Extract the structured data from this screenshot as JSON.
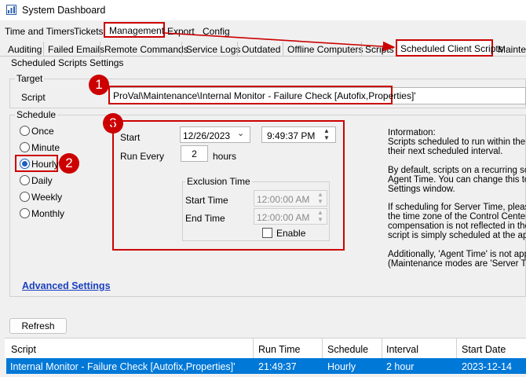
{
  "window": {
    "title": "System Dashboard",
    "icon": "dashboard-icon"
  },
  "menu_tabs": [
    "Time and Timers",
    "Tickets",
    "Management",
    "Export",
    "Config"
  ],
  "sub_tabs": [
    "Auditing",
    "Failed Emails",
    "Remote Commands",
    "Service Logs",
    "Outdated",
    "Offline Computers",
    "Scripts",
    "Scheduled Client Scripts",
    "Mainter"
  ],
  "section_title": "Scheduled Scripts Settings",
  "target": {
    "label": "Target",
    "script_label": "Script",
    "script_value": "ProVal\\Maintenance\\Internal Monitor - Failure Check [Autofix,Properties]'"
  },
  "schedule": {
    "label": "Schedule",
    "options": [
      "Once",
      "Minute",
      "Hourly",
      "Daily",
      "Weekly",
      "Monthly"
    ],
    "selected": "Hourly",
    "start_label": "Start",
    "start_date": "12/26/2023",
    "start_time": "9:49:37 PM",
    "run_every_label": "Run Every",
    "run_every_value": "2",
    "run_every_unit": "hours"
  },
  "exclusion": {
    "label": "Exclusion Time",
    "start_label": "Start Time",
    "start_value": "12:00:00 AM",
    "end_label": "End Time",
    "end_value": "12:00:00 AM",
    "enable_label": "Enable",
    "enabled": false
  },
  "information": [
    "Information:",
    "Scripts scheduled to run within the ne",
    "their next scheduled interval.",
    "",
    "By default, scripts on a recurring sche",
    "Agent Time. You can change this to '",
    "Settings window.",
    "",
    "If scheduling for Server Time, please",
    "the time zone of the Control Center in",
    "compensation is not reflected in the R",
    "script is simply scheduled at the appro",
    "",
    "Additionally, 'Agent Time' is not applic",
    "(Maintenance modes are 'Server Time"
  ],
  "advanced_settings": "Advanced Settings",
  "refresh": "Refresh",
  "grid": {
    "headers": [
      "Script",
      "Run Time",
      "Schedule",
      "Interval",
      "Start Date"
    ],
    "rows": [
      [
        "Internal Monitor - Failure Check [Autofix,Properties]'",
        "21:49:37",
        "Hourly",
        "2 hour",
        "2023-12-14"
      ]
    ]
  },
  "callouts": [
    "1",
    "2",
    "3"
  ],
  "colors": {
    "callout_red": "#cc0000",
    "selection_blue": "#0078d7",
    "link_blue": "#1a3fbf"
  }
}
